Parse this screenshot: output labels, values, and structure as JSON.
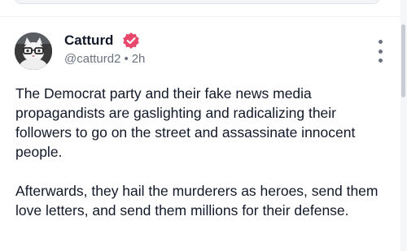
{
  "post": {
    "display_name": "Catturd",
    "handle": "@catturd2",
    "separator": "•",
    "time_ago": "2h",
    "paragraphs": [
      "The Democrat party and their fake news media propagandists are gaslighting and radicalizing their followers to go on the street and assassinate innocent people.",
      "Afterwards, they hail the murderers as heroes, send them love letters, and send them millions for their defense."
    ],
    "icons": {
      "avatar": "cat-avatar",
      "verified": "verified-badge-icon",
      "menu": "more-vertical-icon"
    },
    "colors": {
      "verified_badge": "#e8486b",
      "handle_text": "#6b7280",
      "body_text": "#111827"
    }
  }
}
